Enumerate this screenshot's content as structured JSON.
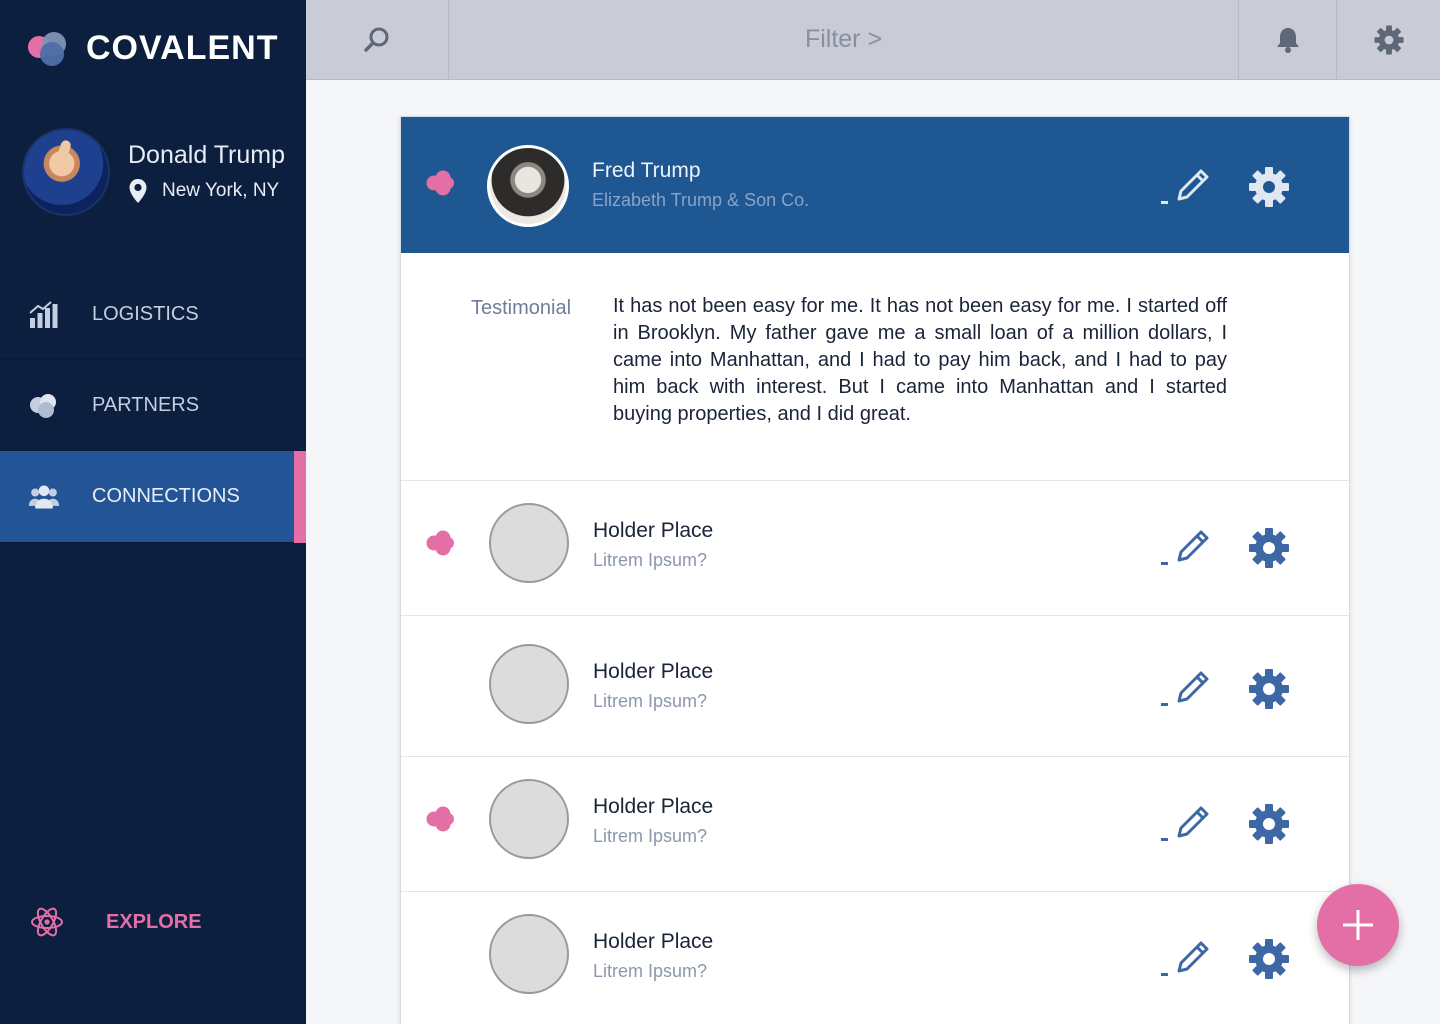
{
  "brand": {
    "name": "COVALENT"
  },
  "profile": {
    "name": "Donald Trump",
    "location": "New York, NY"
  },
  "nav": [
    {
      "label": "LOGISTICS",
      "icon": "bar-chart-icon",
      "active": false
    },
    {
      "label": "PARTNERS",
      "icon": "partners-icon",
      "active": false
    },
    {
      "label": "CONNECTIONS",
      "icon": "users-icon",
      "active": true
    }
  ],
  "explore": {
    "label": "EXPLORE",
    "icon": "atom-icon"
  },
  "topbar": {
    "filter_label": "Filter >",
    "icons": [
      "search-icon",
      "bell-icon",
      "gear-icon"
    ]
  },
  "featured": {
    "name": "Fred Trump",
    "company": "Elizabeth Trump & Son Co.",
    "testimonial_label": "Testimonial",
    "testimonial_text": "It has not been easy for me. It has not been easy for me. I started off in Brooklyn. My father gave me a small loan of a million dollars, I came into Manhattan, and I had to pay him back, and I had to pay him back with interest. But I came into Manhattan and I started buying properties, and I did great."
  },
  "connections": [
    {
      "name": "Holder Place",
      "subtitle": "Litrem Ipsum?",
      "partner": true
    },
    {
      "name": "Holder Place",
      "subtitle": "Litrem Ipsum?",
      "partner": false
    },
    {
      "name": "Holder Place",
      "subtitle": "Litrem Ipsum?",
      "partner": true
    },
    {
      "name": "Holder Place",
      "subtitle": "Litrem Ipsum?",
      "partner": false
    }
  ],
  "colors": {
    "sidebar": "#0c1f3f",
    "active_nav": "#235596",
    "accent_pink": "#e46fa7",
    "header_blue": "#1e5792"
  }
}
